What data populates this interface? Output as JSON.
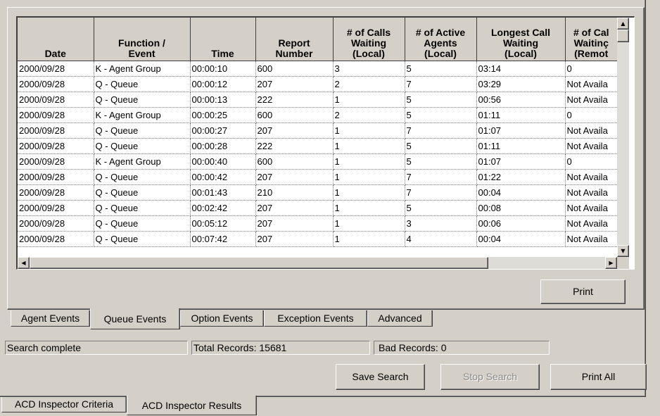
{
  "grid": {
    "columns": [
      "Date",
      "Function /\nEvent",
      "Time",
      "Report\nNumber",
      "# of Calls\nWaiting\n(Local)",
      "# of Active\nAgents\n(Local)",
      "Longest Call\nWaiting\n(Local)",
      "# of Cal\nWaitinç\n(Remot"
    ],
    "rows": [
      [
        "2000/09/28",
        "K - Agent Group",
        "00:00:10",
        "600",
        "3",
        "5",
        "03:14",
        "0"
      ],
      [
        "2000/09/28",
        "Q - Queue",
        "00:00:12",
        "207",
        "2",
        "7",
        "03:29",
        "Not Availa"
      ],
      [
        "2000/09/28",
        "Q - Queue",
        "00:00:13",
        "222",
        "1",
        "5",
        "00:56",
        "Not Availa"
      ],
      [
        "2000/09/28",
        "K - Agent Group",
        "00:00:25",
        "600",
        "2",
        "5",
        "01:11",
        "0"
      ],
      [
        "2000/09/28",
        "Q - Queue",
        "00:00:27",
        "207",
        "1",
        "7",
        "01:07",
        "Not Availa"
      ],
      [
        "2000/09/28",
        "Q - Queue",
        "00:00:28",
        "222",
        "1",
        "5",
        "01:11",
        "Not Availa"
      ],
      [
        "2000/09/28",
        "K - Agent Group",
        "00:00:40",
        "600",
        "1",
        "5",
        "01:07",
        "0"
      ],
      [
        "2000/09/28",
        "Q - Queue",
        "00:00:42",
        "207",
        "1",
        "7",
        "01:22",
        "Not Availa"
      ],
      [
        "2000/09/28",
        "Q - Queue",
        "00:01:43",
        "210",
        "1",
        "7",
        "00:04",
        "Not Availa"
      ],
      [
        "2000/09/28",
        "Q - Queue",
        "00:02:42",
        "207",
        "1",
        "5",
        "00:08",
        "Not Availa"
      ],
      [
        "2000/09/28",
        "Q - Queue",
        "00:05:12",
        "207",
        "1",
        "3",
        "00:06",
        "Not Availa"
      ],
      [
        "2000/09/28",
        "Q - Queue",
        "00:07:42",
        "207",
        "1",
        "4",
        "00:04",
        "Not Availa"
      ]
    ]
  },
  "buttons": {
    "print": "Print",
    "save_search": "Save Search",
    "stop_search": "Stop Search",
    "print_all": "Print All"
  },
  "inner_tabs": [
    {
      "label": "Agent Events",
      "active": false
    },
    {
      "label": "Queue Events",
      "active": true
    },
    {
      "label": "Option Events",
      "active": false
    },
    {
      "label": "Exception Events",
      "active": false
    },
    {
      "label": "Advanced",
      "active": false
    }
  ],
  "status": {
    "message": "Search complete",
    "total_records": "Total Records: 15681",
    "bad_records": "Bad Records: 0"
  },
  "outer_tabs": [
    {
      "label": "ACD Inspector Criteria",
      "active": false
    },
    {
      "label": "ACD Inspector Results",
      "active": true
    }
  ],
  "icons": {
    "scroll_up": "scroll-up-arrow-icon",
    "scroll_down": "scroll-down-arrow-icon",
    "scroll_left": "scroll-left-arrow-icon",
    "scroll_right": "scroll-right-arrow-icon"
  },
  "colors": {
    "face": "#d4d0c8",
    "grid_background": "#ffffff",
    "disabled_text": "#8a8a8a"
  }
}
